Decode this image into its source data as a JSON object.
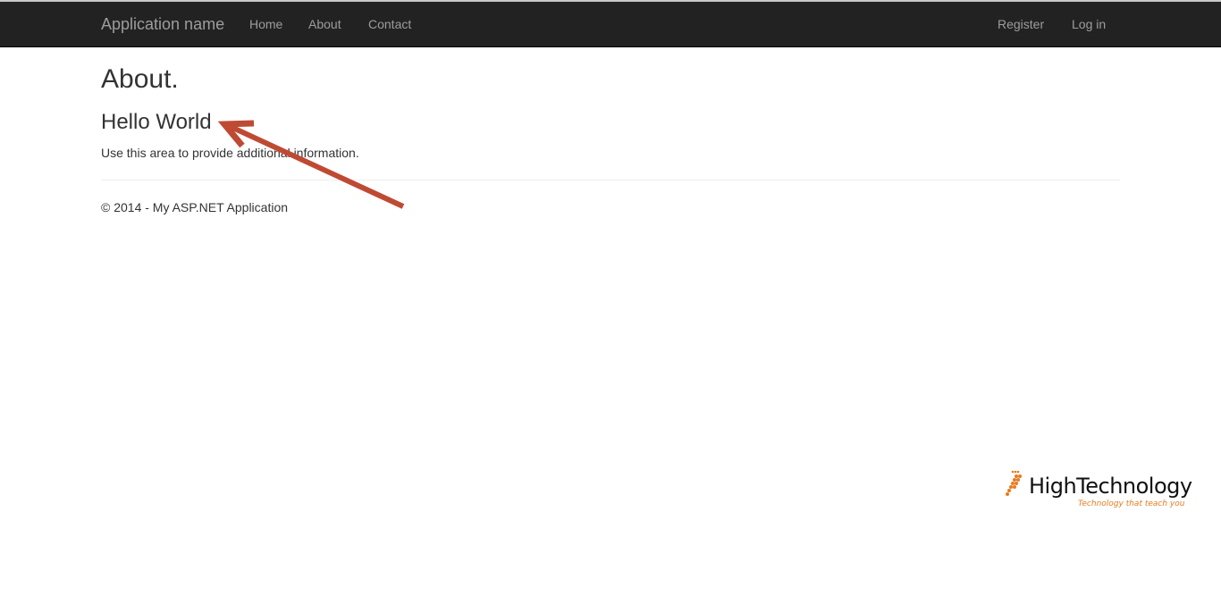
{
  "navbar": {
    "brand": "Application name",
    "links": [
      "Home",
      "About",
      "Contact"
    ],
    "account_links": [
      "Register",
      "Log in"
    ]
  },
  "main": {
    "title": "About.",
    "subtitle": "Hello World",
    "description": "Use this area to provide additional information."
  },
  "footer": {
    "text": "© 2014 - My ASP.NET Application"
  },
  "annotation": {
    "arrow_color": "#bf4a33"
  },
  "watermark": {
    "name": "HighTechnology",
    "tagline": "Technology that teach you",
    "accent_color": "#e87b1e"
  }
}
